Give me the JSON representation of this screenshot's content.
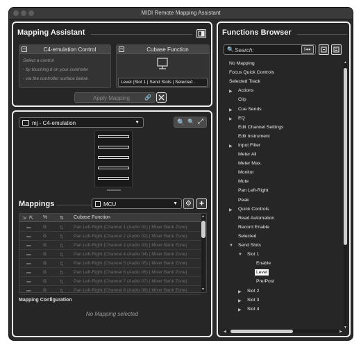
{
  "window": {
    "title": "MIDI Remote Mapping Assistant"
  },
  "mapping_assistant": {
    "title": "Mapping Assistant",
    "control_card": {
      "title": "C4-emulation Control",
      "hints": [
        "Select a control",
        "- by touching it on your controller",
        "- via the controller surface below"
      ]
    },
    "function_card": {
      "title": "Cubase Function",
      "value": "Level (Slot 1 | Send Slots | Selected ."
    },
    "apply_label": "Apply Mapping"
  },
  "controller": {
    "device_label": "mj - C4-emulation"
  },
  "mappings": {
    "title": "Mappings",
    "page_label": "MCU",
    "column_header": "Cubase Function",
    "row_col2": "G",
    "rows": [
      "Pan Left-Right (Channel 1 (Audio 01) | Mixer Bank Zone)",
      "Pan Left-Right (Channel 2 (Audio 02) | Mixer Bank Zone)",
      "Pan Left-Right (Channel 3 (Audio 03) | Mixer Bank Zone)",
      "Pan Left-Right (Channel 4 (Audio 04) | Mixer Bank Zone)",
      "Pan Left-Right (Channel 5 (Audio 05) | Mixer Bank Zone)",
      "Pan Left-Right (Channel 6 (Audio 06) | Mixer Bank Zone)",
      "Pan Left-Right (Channel 7 (Audio 07) | Mixer Bank Zone)",
      "Pan Left-Right (Channel 8 (Audio 08) | Mixer Bank Zone)"
    ],
    "config_title": "Mapping Configuration",
    "config_empty": "No Mapping selected"
  },
  "functions_browser": {
    "title": "Functions Browser",
    "search_placeholder": "Search:",
    "tree": [
      {
        "label": "No Mapping",
        "depth": 0,
        "arrow": ""
      },
      {
        "label": "Focus Quick Controls",
        "depth": 0,
        "arrow": "right"
      },
      {
        "label": "Selected Track",
        "depth": 0,
        "arrow": "down"
      },
      {
        "label": "Actions",
        "depth": 1,
        "arrow": "right"
      },
      {
        "label": "Clip",
        "depth": 1,
        "arrow": ""
      },
      {
        "label": "Cue Sends",
        "depth": 1,
        "arrow": "right"
      },
      {
        "label": "EQ",
        "depth": 1,
        "arrow": "right"
      },
      {
        "label": "Edit Channel Settings",
        "depth": 1,
        "arrow": ""
      },
      {
        "label": "Edit Instrument",
        "depth": 1,
        "arrow": ""
      },
      {
        "label": "Input Filter",
        "depth": 1,
        "arrow": "right"
      },
      {
        "label": "Meter All",
        "depth": 1,
        "arrow": ""
      },
      {
        "label": "Meter Max.",
        "depth": 1,
        "arrow": ""
      },
      {
        "label": "Monitor",
        "depth": 1,
        "arrow": ""
      },
      {
        "label": "Mute",
        "depth": 1,
        "arrow": ""
      },
      {
        "label": "Pan Left-Right",
        "depth": 1,
        "arrow": ""
      },
      {
        "label": "Peak",
        "depth": 1,
        "arrow": ""
      },
      {
        "label": "Quick Controls",
        "depth": 1,
        "arrow": "right"
      },
      {
        "label": "Read Automation",
        "depth": 1,
        "arrow": ""
      },
      {
        "label": "Record Enable",
        "depth": 1,
        "arrow": ""
      },
      {
        "label": "Selected",
        "depth": 1,
        "arrow": ""
      },
      {
        "label": "Send Slots",
        "depth": 1,
        "arrow": "down"
      },
      {
        "label": "Slot 1",
        "depth": 2,
        "arrow": "down"
      },
      {
        "label": "Enable",
        "depth": 3,
        "arrow": ""
      },
      {
        "label": "Level",
        "depth": 3,
        "arrow": "",
        "selected": true
      },
      {
        "label": "Pre/Post",
        "depth": 3,
        "arrow": ""
      },
      {
        "label": "Slot 2",
        "depth": 2,
        "arrow": "right"
      },
      {
        "label": "Slot 3",
        "depth": 2,
        "arrow": "right"
      },
      {
        "label": "Slot 4",
        "depth": 2,
        "arrow": "right"
      }
    ]
  },
  "colors": {
    "panel_border": "#f2f2f2",
    "selected_bg": "#ffffff",
    "selected_fg": "#000000"
  }
}
